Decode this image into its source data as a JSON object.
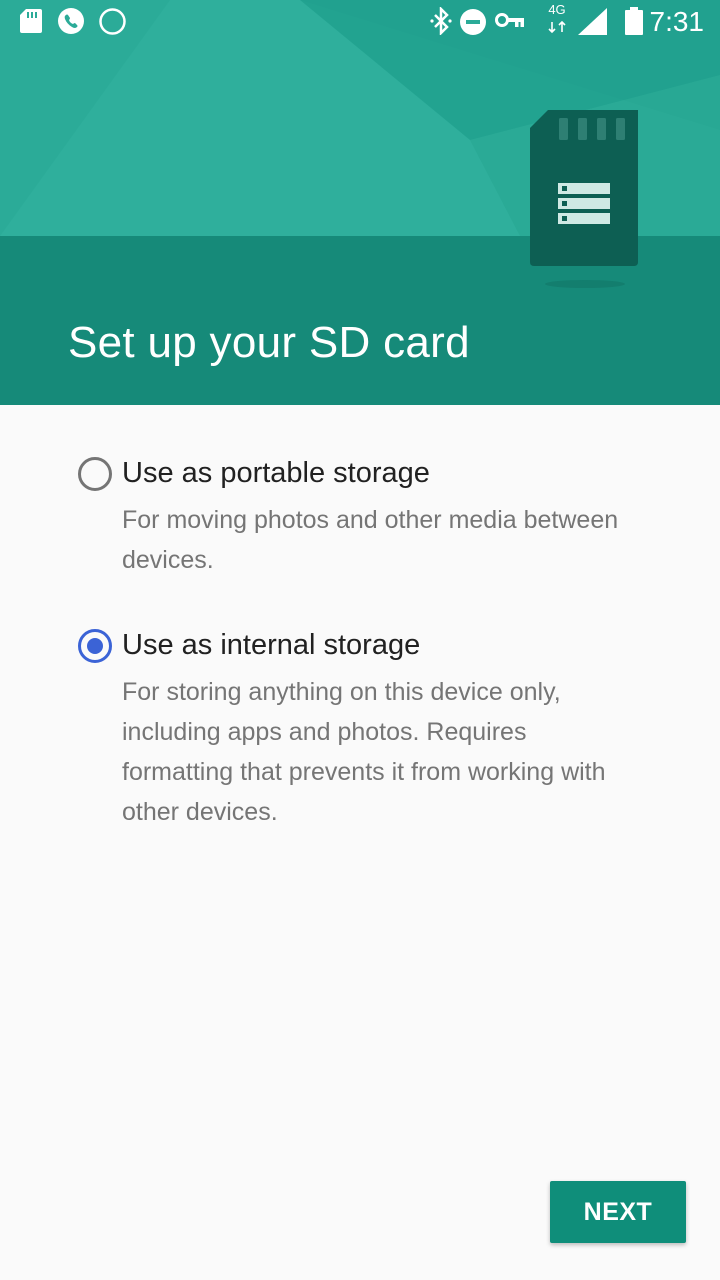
{
  "status_bar": {
    "time": "7:31",
    "network_type": "4G",
    "icons": [
      "sd-card-icon",
      "phone-icon",
      "circle-icon",
      "bluetooth-icon",
      "do-not-disturb-icon",
      "vpn-key-icon",
      "signal-icon",
      "battery-icon"
    ]
  },
  "header": {
    "title": "Set up your SD card",
    "illustration": "sd-card-icon",
    "colors": {
      "upper": "#2bab98",
      "lower": "#168a79"
    }
  },
  "options": [
    {
      "title": "Use as portable storage",
      "description": "For moving photos and other media between devices.",
      "selected": false
    },
    {
      "title": "Use as internal storage",
      "description": "For storing anything on this device only, including apps and photos. Requires formatting that prevents it from working with other devices.",
      "selected": true
    }
  ],
  "next_button": {
    "label": "NEXT",
    "color": "#0f8e7a"
  },
  "accent_color": "#3b63d6"
}
